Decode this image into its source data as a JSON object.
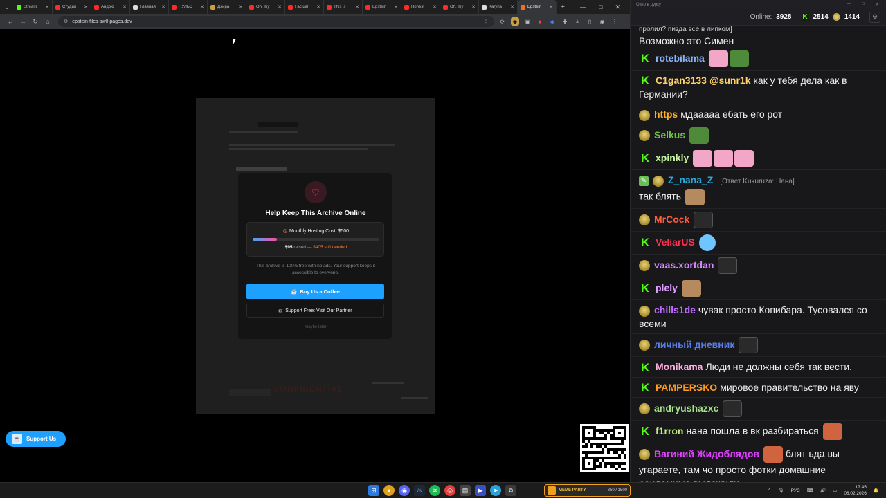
{
  "browser": {
    "tabs": [
      {
        "title": "Stream",
        "color": "#53fc18"
      },
      {
        "title": "Студия",
        "color": "#ff2a2a"
      },
      {
        "title": "Андрю",
        "color": "#ff2a2a"
      },
      {
        "title": "Главная",
        "color": "#dddddd"
      },
      {
        "title": "ПУЛЬС",
        "color": "#ff2a2a"
      },
      {
        "title": "Дэйра",
        "color": "#c8a040"
      },
      {
        "title": "Oh, my",
        "color": "#ff2a2a"
      },
      {
        "title": "I actual",
        "color": "#ff2a2a"
      },
      {
        "title": "This is",
        "color": "#ff2a2a"
      },
      {
        "title": "Epstein",
        "color": "#ff2a2a"
      },
      {
        "title": "Honest",
        "color": "#ff2a2a"
      },
      {
        "title": "Oh, my",
        "color": "#ff2a2a"
      },
      {
        "title": "Karyna",
        "color": "#dddddd"
      },
      {
        "title": "Epstein",
        "color": "#f07020",
        "active": true
      }
    ],
    "url": "epstein-files-sw0.pages.dev"
  },
  "modal": {
    "title": "Help Keep This Archive Online",
    "cost_label": "Monthly Hosting Cost: $500",
    "progress": 0.19,
    "raised_amount": "$95",
    "raised_word": "raised —",
    "needed": "$405 still needed",
    "free_text": "This archive is 100% free with no ads. Your support keeps it accessible to everyone.",
    "coffee_button": "Buy Us a Coffee",
    "partner_button": "Support Free: Visit Our Partner",
    "maybe_later": "maybe later"
  },
  "background_doc": {
    "stamp": "CONFIDENTIAL"
  },
  "support_pill": "Support Us",
  "chat": {
    "window_title": "Окно в дурку",
    "online_label": "Online:",
    "online_value": "3928",
    "kick_count": "2514",
    "gold_count": "1414",
    "messages": [
      {
        "text": "пролил? пизда все в липком]",
        "partial": true
      },
      {
        "text": "Возможно это Симен",
        "partial": true
      },
      {
        "badge": "kick",
        "user": "rotebilama",
        "color": "#8ab4f8",
        "emotes": [
          "pink",
          "frog"
        ]
      },
      {
        "badge": "kick",
        "user": "C1gan3133",
        "color": "#ffd36a",
        "mention": "@sunr1k",
        "text": "как у тебя дела как в Германии?"
      },
      {
        "badge": "gold",
        "user": "https",
        "color": "#ffb020",
        "text": "мдааааа ебать его рот"
      },
      {
        "badge": "gold",
        "user": "Selkus",
        "color": "#6cc644",
        "emotes": [
          "frog"
        ]
      },
      {
        "badge": "kick",
        "user": "xpinkly",
        "color": "#c8f7a0",
        "emotes": [
          "pink",
          "pink",
          "pink"
        ]
      },
      {
        "badge": "pen",
        "user": "Z_nana_Z",
        "color": "#2aa8d8",
        "reply": "[Ответ Kukuruza: Нана]",
        "text": "так блять",
        "emotes": [
          "cap"
        ]
      },
      {
        "badge": "gold",
        "user": "MrCock",
        "color": "#ff5a3a",
        "emotes": [
          "cat"
        ]
      },
      {
        "badge": "kick",
        "user": "VeliarUS",
        "color": "#ff3050",
        "emotes": [
          "blue"
        ]
      },
      {
        "badge": "gold",
        "user": "vaas.xortdan",
        "color": "#d98cff",
        "emotes": [
          "cat"
        ]
      },
      {
        "badge": "kick",
        "user": "plely",
        "color": "#e0a0ff",
        "emotes": [
          "cap"
        ]
      },
      {
        "badge": "gold",
        "user": "chills1de",
        "color": "#c06cff",
        "text": "чувак просто Копибара. Тусовался со всеми"
      },
      {
        "badge": "gold",
        "user": "личный дневник",
        "color": "#5a7ee8",
        "emotes": [
          "cat"
        ]
      },
      {
        "badge": "kick",
        "user": "Monikama",
        "color": "#ffb0e0",
        "text": "Люди не должны себя так вести."
      },
      {
        "badge": "kick",
        "user": "PAMPERSKO",
        "color": "#ff9a20",
        "text": "мировое правительство на яву"
      },
      {
        "badge": "gold",
        "user": "andryushazxc",
        "color": "#a6e08a",
        "emotes": [
          "cat"
        ]
      },
      {
        "badge": "kick",
        "user": "f1rron",
        "color": "#c0f080",
        "text": "нана пошла в вк разбираться",
        "emotes": [
          "face"
        ]
      },
      {
        "badge": "gold",
        "user": "Вагиний Жидоблядов",
        "color": "#e040ff",
        "emotes": [
          "face"
        ],
        "text": "блят ьда вы угараете, там чо просто фотки домашние рандомные выложили"
      }
    ]
  },
  "taskbar": {
    "meme_label": "MEME PARTY",
    "meme_count": "850 / 1500",
    "lang": "РУС",
    "time": "17:45",
    "date": "08.02.2026"
  }
}
